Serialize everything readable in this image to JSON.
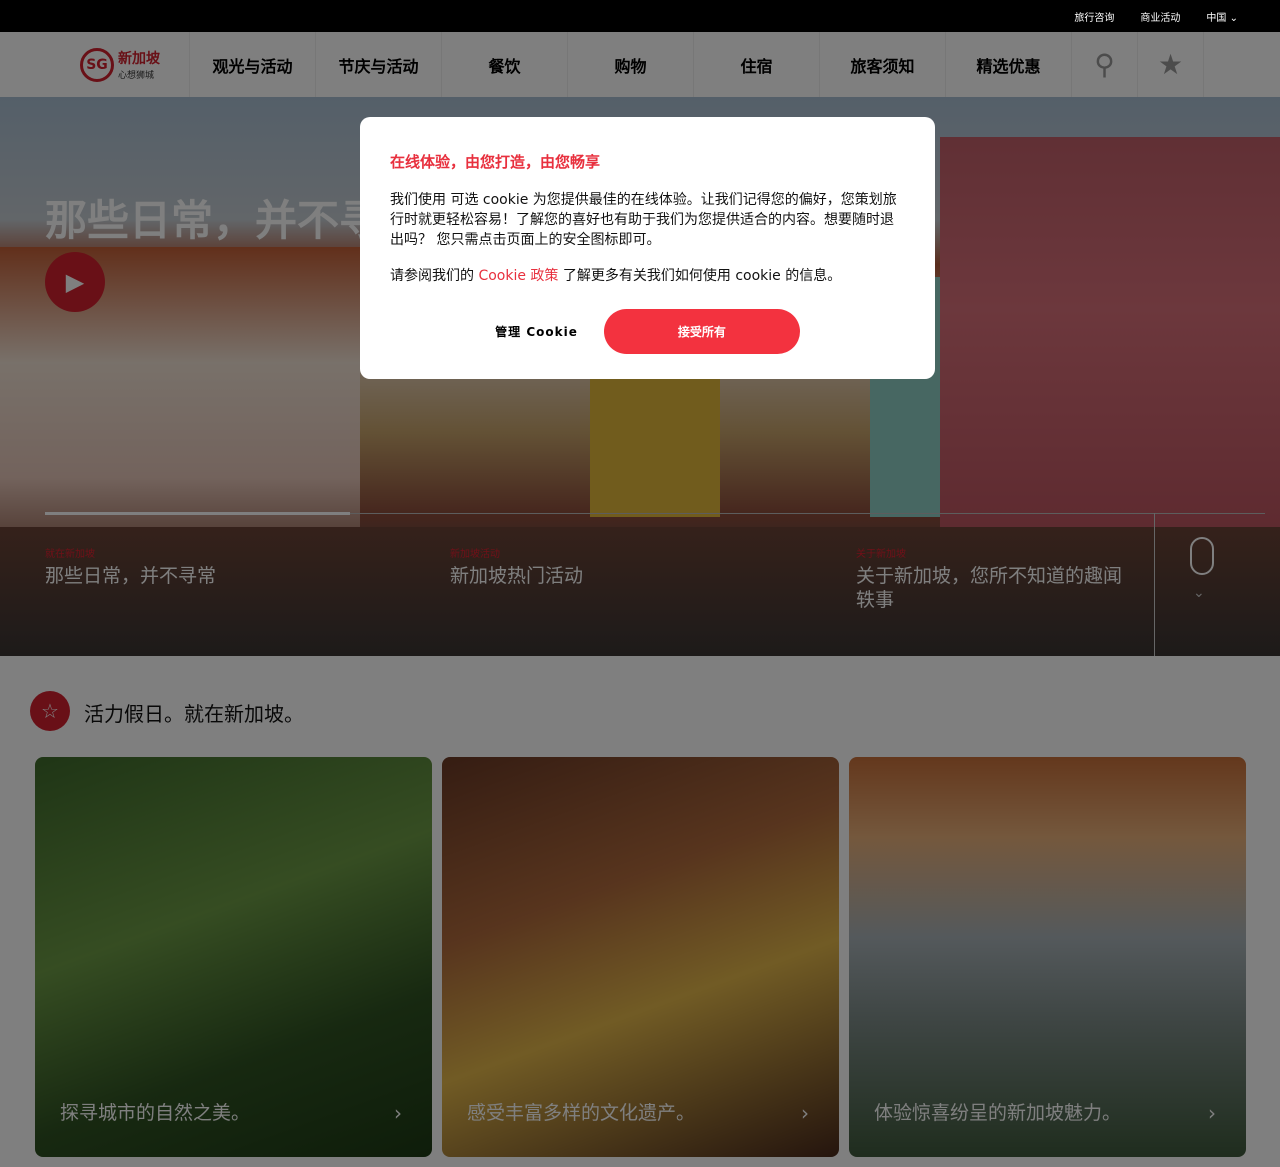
{
  "topbar": {
    "links": [
      "旅行咨询",
      "商业活动"
    ],
    "language": "中国"
  },
  "logo": {
    "mark": "SG",
    "name": "新加坡",
    "tagline": "心想狮城"
  },
  "nav": {
    "items": [
      "观光与活动",
      "节庆与活动",
      "餐饮",
      "购物",
      "住宿",
      "旅客须知",
      "精选优惠"
    ]
  },
  "hero": {
    "title": "那些日常，并不寻常",
    "slides": [
      {
        "kicker": "就在新加坡",
        "title": "那些日常，并不寻常"
      },
      {
        "kicker": "新加坡活动",
        "title": "新加坡热门活动"
      },
      {
        "kicker": "关于新加坡",
        "title": "关于新加坡，您所不知道的趣闻轶事"
      }
    ],
    "progress": 0.25
  },
  "section": {
    "title": "活力假日。就在新加坡。",
    "cards": [
      {
        "label": "探寻城市的自然之美。"
      },
      {
        "label": "感受丰富多样的文化遗产。"
      },
      {
        "label": "体验惊喜纷呈的新加坡魅力。"
      }
    ]
  },
  "cookie": {
    "title": "在线体验，由您打造，由您畅享",
    "body": "我们使用 可选 cookie 为您提供最佳的在线体验。让我们记得您的偏好，您策划旅行时就更轻松容易！了解您的喜好也有助于我们为您提供适合的内容。想要随时退出吗？ 您只需点击页面上的安全图标即可。",
    "policy_pre": "请参阅我们的 ",
    "policy_link": "Cookie 政策",
    "policy_post": " 了解更多有关我们如何使用 cookie 的信息。",
    "manage_label": "管理 Cookie",
    "accept_label": "接受所有"
  },
  "colors": {
    "brand": "#d3202e",
    "accept": "#f3323f"
  }
}
